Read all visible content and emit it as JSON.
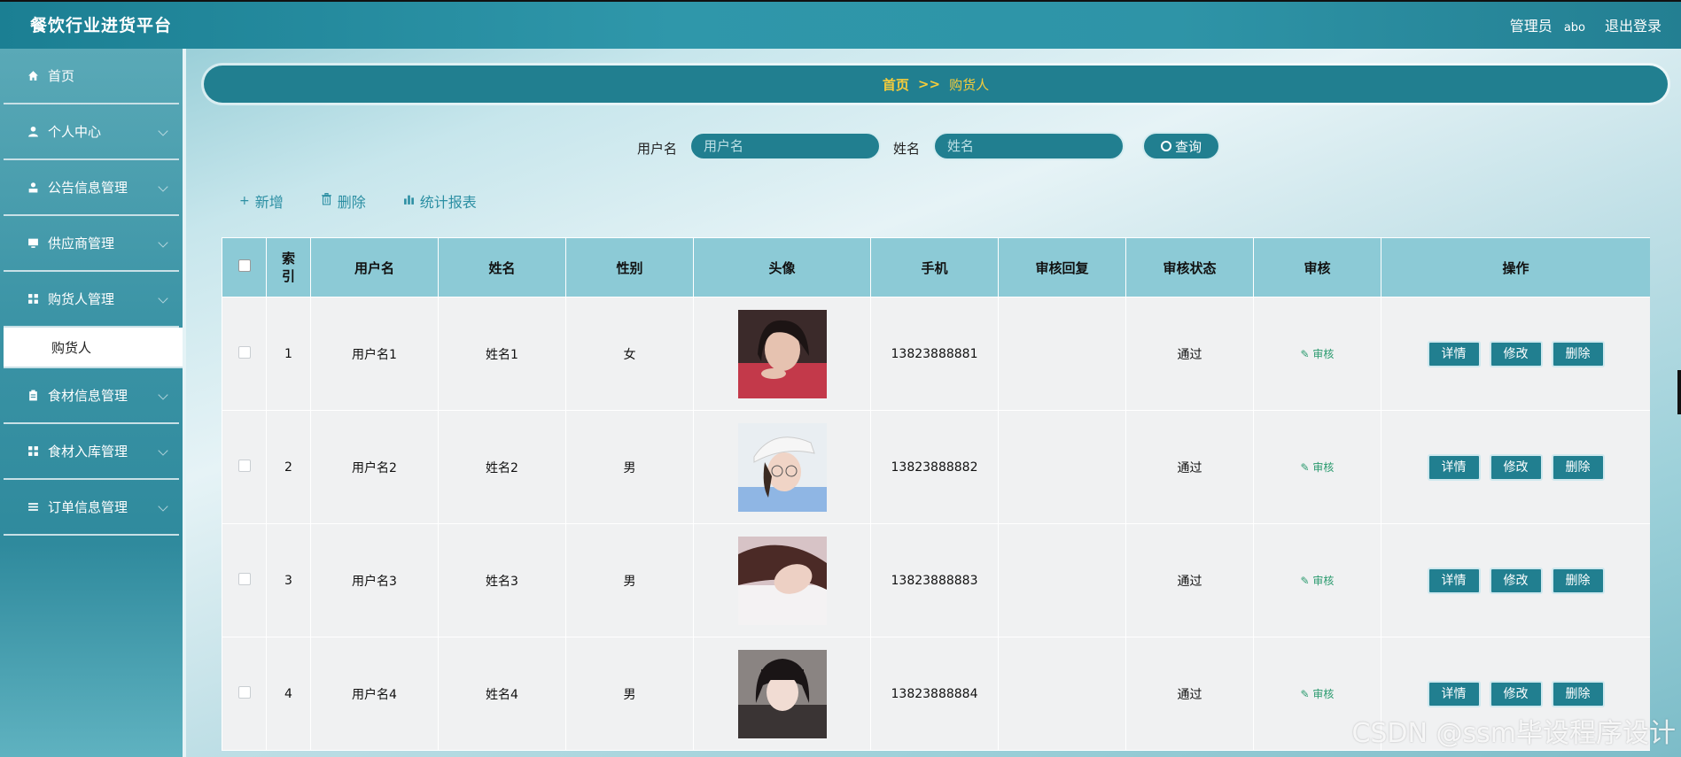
{
  "header": {
    "title": "餐饮行业进货平台",
    "admin_role": "管理员",
    "admin_user": "abo",
    "logout": "退出登录"
  },
  "sidebar": {
    "items": [
      {
        "label": "首页",
        "icon": "home-icon"
      },
      {
        "label": "个人中心",
        "icon": "user-icon"
      },
      {
        "label": "公告信息管理",
        "icon": "user-badge-icon"
      },
      {
        "label": "供应商管理",
        "icon": "monitor-icon"
      },
      {
        "label": "购货人管理",
        "icon": "grid-icon"
      },
      {
        "label": "食材信息管理",
        "icon": "clipboard-icon"
      },
      {
        "label": "食材入库管理",
        "icon": "grid-icon"
      },
      {
        "label": "订单信息管理",
        "icon": "list-icon"
      }
    ],
    "active_sub": "购货人"
  },
  "breadcrumb": {
    "home": "首页",
    "separator": ">>",
    "current": "购货人"
  },
  "search": {
    "username_label": "用户名",
    "username_placeholder": "用户名",
    "name_label": "姓名",
    "name_placeholder": "姓名",
    "button": "查询"
  },
  "toolbar": {
    "add": "新增",
    "delete": "删除",
    "report": "统计报表"
  },
  "table": {
    "headers": [
      "索引",
      "用户名",
      "姓名",
      "性别",
      "头像",
      "手机",
      "审核回复",
      "审核状态",
      "审核",
      "操作"
    ],
    "review_link": "审核",
    "actions": [
      "详情",
      "修改",
      "删除"
    ],
    "rows": [
      {
        "index": "1",
        "username": "用户名1",
        "name": "姓名1",
        "gender": "女",
        "phone": "13823888881",
        "reply": "",
        "status": "通过"
      },
      {
        "index": "2",
        "username": "用户名2",
        "name": "姓名2",
        "gender": "男",
        "phone": "13823888882",
        "reply": "",
        "status": "通过"
      },
      {
        "index": "3",
        "username": "用户名3",
        "name": "姓名3",
        "gender": "男",
        "phone": "13823888883",
        "reply": "",
        "status": "通过"
      },
      {
        "index": "4",
        "username": "用户名4",
        "name": "姓名4",
        "gender": "男",
        "phone": "13823888884",
        "reply": "",
        "status": "通过"
      }
    ]
  },
  "watermark": "CSDN @ssm毕设程序设计",
  "colors": {
    "primary": "#217f90",
    "header_row": "#8ccad6",
    "crumb_text": "#f5cc3b",
    "link": "#2c8fa3",
    "review": "#2a9a6e"
  }
}
